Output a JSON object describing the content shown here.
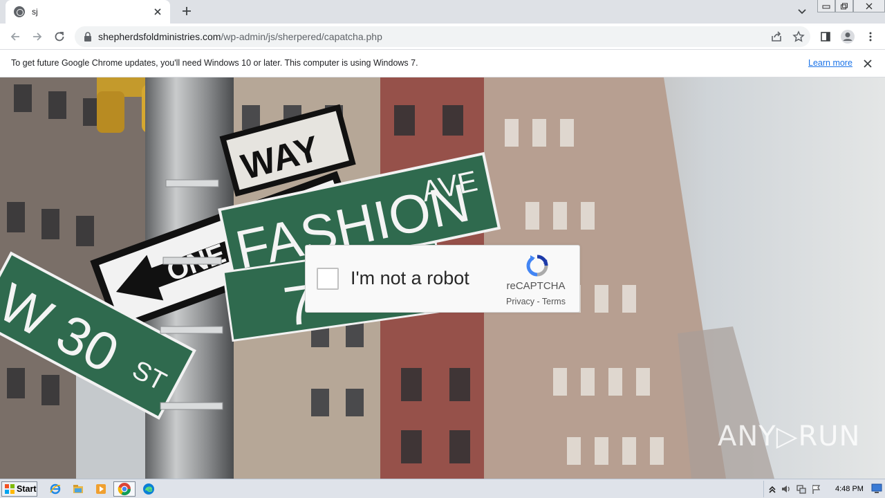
{
  "browser": {
    "tab": {
      "title": "sj",
      "favicon": "globe-icon",
      "close_icon": "close-icon"
    },
    "newtab_icon": "plus-icon",
    "address": {
      "host": "shepherdsfoldministries.com",
      "path": "/wp-admin/js/sherpered/capatcha.php"
    },
    "infobar": {
      "message": "To get future Google Chrome updates, you'll need Windows 10 or later. This computer is using Windows 7.",
      "link": "Learn more"
    }
  },
  "page": {
    "background": "street-signs-photo",
    "recaptcha": {
      "label": "I'm not a robot",
      "brand": "reCAPTCHA",
      "privacy": "Privacy",
      "separator": " - ",
      "terms": "Terms",
      "checked": false
    },
    "watermark": "ANY▷RUN"
  },
  "taskbar": {
    "start_label": "Start",
    "clock": "4:48 PM",
    "apps": [
      "ie-icon",
      "explorer-icon",
      "media-player-icon",
      "chrome-icon",
      "edge-icon"
    ]
  },
  "colors": {
    "accent": "#1a73e8",
    "sign_green": "#2f6a4e",
    "taskbar": "#dfe3ea"
  }
}
